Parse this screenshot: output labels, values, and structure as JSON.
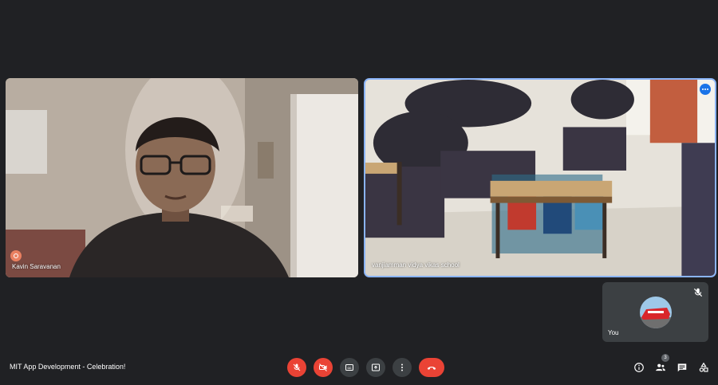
{
  "meeting": {
    "title": "MIT App Development - Celebration!"
  },
  "participants": {
    "left": {
      "name": "Kavin Saravanan"
    },
    "right": {
      "name": "vanjiamman vidya vikas school"
    },
    "self": {
      "name": "You",
      "muted": true
    }
  },
  "controls": {
    "mic": {
      "icon": "mic-off-icon",
      "state": "off",
      "color": "#ea4335"
    },
    "camera": {
      "icon": "camera-off-icon",
      "state": "off",
      "color": "#ea4335"
    },
    "captions": {
      "icon": "captions-icon",
      "text": "CC"
    },
    "present": {
      "icon": "present-icon"
    },
    "more": {
      "icon": "more-vert-icon"
    },
    "hangup": {
      "icon": "hangup-icon",
      "color": "#ea4335"
    }
  },
  "right_controls": {
    "info": {
      "icon": "info-icon"
    },
    "people": {
      "icon": "people-icon",
      "count": "3"
    },
    "chat": {
      "icon": "chat-icon"
    },
    "activities": {
      "icon": "activities-icon"
    }
  },
  "colors": {
    "background": "#202124",
    "tile": "#3c4043",
    "active_border": "#8ab4f8",
    "accent": "#1a73e8"
  }
}
